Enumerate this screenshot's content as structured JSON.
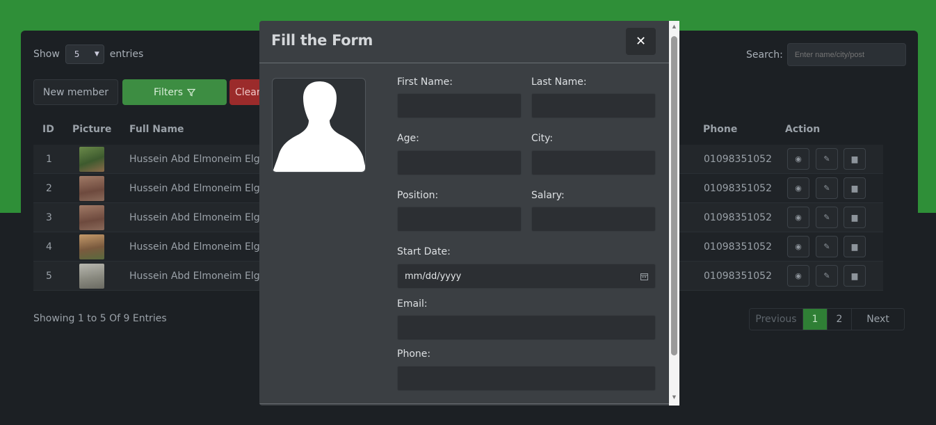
{
  "page": {
    "show_label": "Show",
    "entries_value": "5",
    "entries_label": "entries",
    "search_label": "Search:",
    "search_placeholder": "Enter name/city/post",
    "new_member": "New member",
    "filters": "Filters",
    "clear": "Clear",
    "columns": {
      "id": "ID",
      "picture": "Picture",
      "full_name": "Full Name",
      "phone": "Phone",
      "action": "Action"
    },
    "rows": [
      {
        "id": "1",
        "name": "Hussein Abd Elmoneim Elgee",
        "phone": "01098351052"
      },
      {
        "id": "2",
        "name": "Hussein Abd Elmoneim Elgee",
        "phone": "01098351052"
      },
      {
        "id": "3",
        "name": "Hussein Abd Elmoneim Elgee",
        "phone": "01098351052"
      },
      {
        "id": "4",
        "name": "Hussein Abd Elmoneim Elgee",
        "phone": "01098351052"
      },
      {
        "id": "5",
        "name": "Hussein Abd Elmoneim Elgee",
        "phone": "01098351052"
      }
    ],
    "footer": "Showing 1 to 5 Of 9 Entries",
    "pagination": {
      "previous": "Previous",
      "pages": [
        "1",
        "2"
      ],
      "active_page": "1",
      "next": "Next"
    }
  },
  "modal": {
    "title": "Fill the Form",
    "close": "✕",
    "labels": {
      "first_name": "First Name:",
      "last_name": "Last Name:",
      "age": "Age:",
      "city": "City:",
      "position": "Position:",
      "salary": "Salary:",
      "start_date": "Start Date:",
      "email": "Email:",
      "phone": "Phone:"
    },
    "start_date_placeholder": "mm/dd/yyyy"
  },
  "colors": {
    "brand_green": "#2f8f38",
    "modal_bg": "#3b3f43",
    "danger": "#9b2b2b"
  },
  "icons": [
    "filter-icon",
    "eye-icon",
    "edit-icon",
    "trash-icon",
    "close-icon",
    "calendar-icon",
    "avatar-silhouette-icon"
  ]
}
